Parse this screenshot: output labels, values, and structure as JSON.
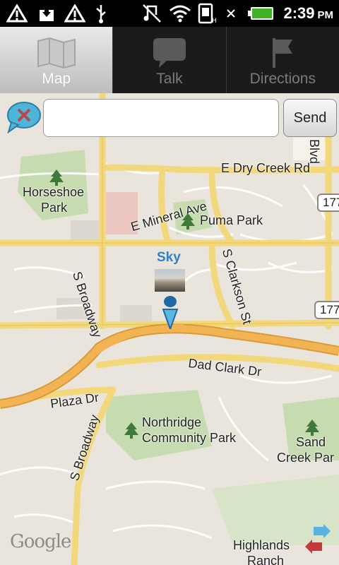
{
  "status_bar": {
    "time": "2:39",
    "ampm": "PM",
    "icons": [
      "warning-icon",
      "download-icon",
      "warning-icon",
      "usb-icon",
      "music-off-icon",
      "wifi-icon",
      "phone-signal-icon",
      "battery-icon"
    ]
  },
  "tabs": [
    {
      "label": "Map",
      "active": true,
      "icon": "map-icon"
    },
    {
      "label": "Talk",
      "active": false,
      "icon": "speech-bubble-icon"
    },
    {
      "label": "Directions",
      "active": false,
      "icon": "flag-icon"
    }
  ],
  "chat": {
    "input_value": "",
    "send_label": "Send"
  },
  "marker": {
    "name": "Sky"
  },
  "map": {
    "streets": {
      "dry_creek": "E Dry Creek Rd",
      "mineral": "E Mineral Ave",
      "broadway1": "S Broadway",
      "clarkson": "S Clarkson St",
      "dad_clark": "Dad Clark Dr",
      "plaza": "Plaza Dr",
      "broadway2": "S Broadway",
      "blvd": "Blvd"
    },
    "places": {
      "horseshoe_1": "Horseshoe",
      "horseshoe_2": "Park",
      "puma": "Puma Park",
      "northridge_1": "Northridge",
      "northridge_2": "Community Park",
      "sand_1": "Sand",
      "sand_2": "Creek Par",
      "highlands_1": "Highlands",
      "highlands_2": "Ranch"
    },
    "shields": [
      "177",
      "177"
    ],
    "attribution": "Google"
  }
}
